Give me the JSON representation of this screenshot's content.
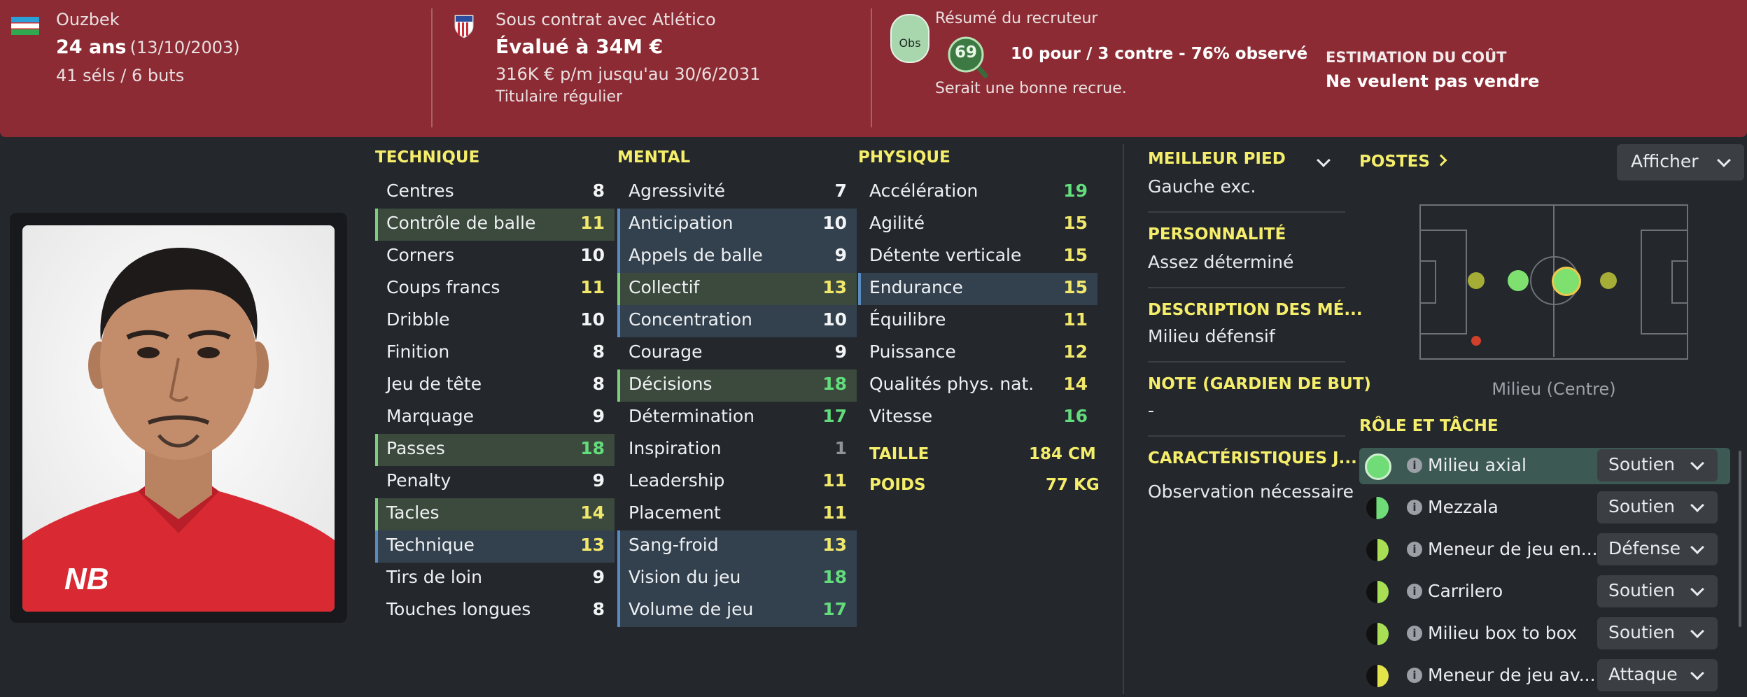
{
  "header": {
    "nationality": "Ouzbek",
    "age": "24 ans",
    "dob": "(13/10/2003)",
    "caps": "41 séls / 6 buts",
    "contract": "Sous contrat avec Atlético",
    "value": "Évalué à 34M €",
    "wage": "316K € p/m jusqu'au 30/6/2031",
    "status": "Titulaire régulier",
    "scout_badge": "Obs",
    "scout_title": "Résumé du recruteur",
    "scout_rating": "69",
    "scout_votes": "10 pour / 3 contre - 76% observé",
    "scout_comment": "Serait une bonne recrue.",
    "cost_title": "ESTIMATION DU COÛT",
    "cost_value": "Ne veulent pas vendre"
  },
  "columns": {
    "technique": {
      "title": "TECHNIQUE",
      "rows": [
        {
          "label": "Centres",
          "value": "8"
        },
        {
          "label": "Contrôle de balle",
          "value": "11"
        },
        {
          "label": "Corners",
          "value": "10"
        },
        {
          "label": "Coups francs",
          "value": "11"
        },
        {
          "label": "Dribble",
          "value": "10"
        },
        {
          "label": "Finition",
          "value": "8"
        },
        {
          "label": "Jeu de tête",
          "value": "8"
        },
        {
          "label": "Marquage",
          "value": "9"
        },
        {
          "label": "Passes",
          "value": "18"
        },
        {
          "label": "Penalty",
          "value": "9"
        },
        {
          "label": "Tacles",
          "value": "14"
        },
        {
          "label": "Technique",
          "value": "13"
        },
        {
          "label": "Tirs de loin",
          "value": "9"
        },
        {
          "label": "Touches longues",
          "value": "8"
        }
      ]
    },
    "mental": {
      "title": "MENTAL",
      "rows": [
        {
          "label": "Agressivité",
          "value": "7"
        },
        {
          "label": "Anticipation",
          "value": "10"
        },
        {
          "label": "Appels de balle",
          "value": "9"
        },
        {
          "label": "Collectif",
          "value": "13"
        },
        {
          "label": "Concentration",
          "value": "10"
        },
        {
          "label": "Courage",
          "value": "9"
        },
        {
          "label": "Décisions",
          "value": "18"
        },
        {
          "label": "Détermination",
          "value": "17"
        },
        {
          "label": "Inspiration",
          "value": "1"
        },
        {
          "label": "Leadership",
          "value": "11"
        },
        {
          "label": "Placement",
          "value": "11"
        },
        {
          "label": "Sang-froid",
          "value": "13"
        },
        {
          "label": "Vision du jeu",
          "value": "18"
        },
        {
          "label": "Volume de jeu",
          "value": "17"
        }
      ]
    },
    "physique": {
      "title": "PHYSIQUE",
      "rows": [
        {
          "label": "Accélération",
          "value": "19"
        },
        {
          "label": "Agilité",
          "value": "15"
        },
        {
          "label": "Détente verticale",
          "value": "15"
        },
        {
          "label": "Endurance",
          "value": "15"
        },
        {
          "label": "Équilibre",
          "value": "11"
        },
        {
          "label": "Puissance",
          "value": "12"
        },
        {
          "label": "Qualités phys. nat.",
          "value": "14"
        },
        {
          "label": "Vitesse",
          "value": "16"
        }
      ],
      "height_label": "TAILLE",
      "height_value": "184 CM",
      "weight_label": "POIDS",
      "weight_value": "77 KG"
    }
  },
  "info": {
    "foot_title": "MEILLEUR PIED",
    "foot_value": "Gauche exc.",
    "personality_title": "PERSONNALITÉ",
    "personality_value": "Assez déterminé",
    "media_title": "DESCRIPTION DES MÉ...",
    "media_value": "Milieu défensif",
    "gk_title": "NOTE (GARDIEN DE BUT)",
    "gk_value": "-",
    "traits_title": "CARACTÉRISTIQUES J...",
    "traits_value": "Observation nécessaire"
  },
  "positions": {
    "title": "POSTES",
    "button": "Afficher",
    "caption": "Milieu (Centre)"
  },
  "roles": {
    "title": "RÔLE ET TÂCHE",
    "items": [
      {
        "name": "Milieu axial",
        "duty": "Soutien"
      },
      {
        "name": "Mezzala",
        "duty": "Soutien"
      },
      {
        "name": "Meneur de jeu en...",
        "duty": "Défense"
      },
      {
        "name": "Carrilero",
        "duty": "Soutien"
      },
      {
        "name": "Milieu box to box",
        "duty": "Soutien"
      },
      {
        "name": "Meneur de jeu av...",
        "duty": "Attaque"
      }
    ]
  },
  "colors": {
    "header_bg": "#8c2b34",
    "accent_yellow": "#f5ee6a",
    "attr_green": "#63dc7c",
    "attr_yellow": "#f1e86b",
    "rating_green": "#5fbf5c"
  },
  "icons": {
    "flag": "flag-uzbekistan-icon",
    "club": "atletico-crest-icon",
    "chevron": "chevron-down-icon"
  }
}
